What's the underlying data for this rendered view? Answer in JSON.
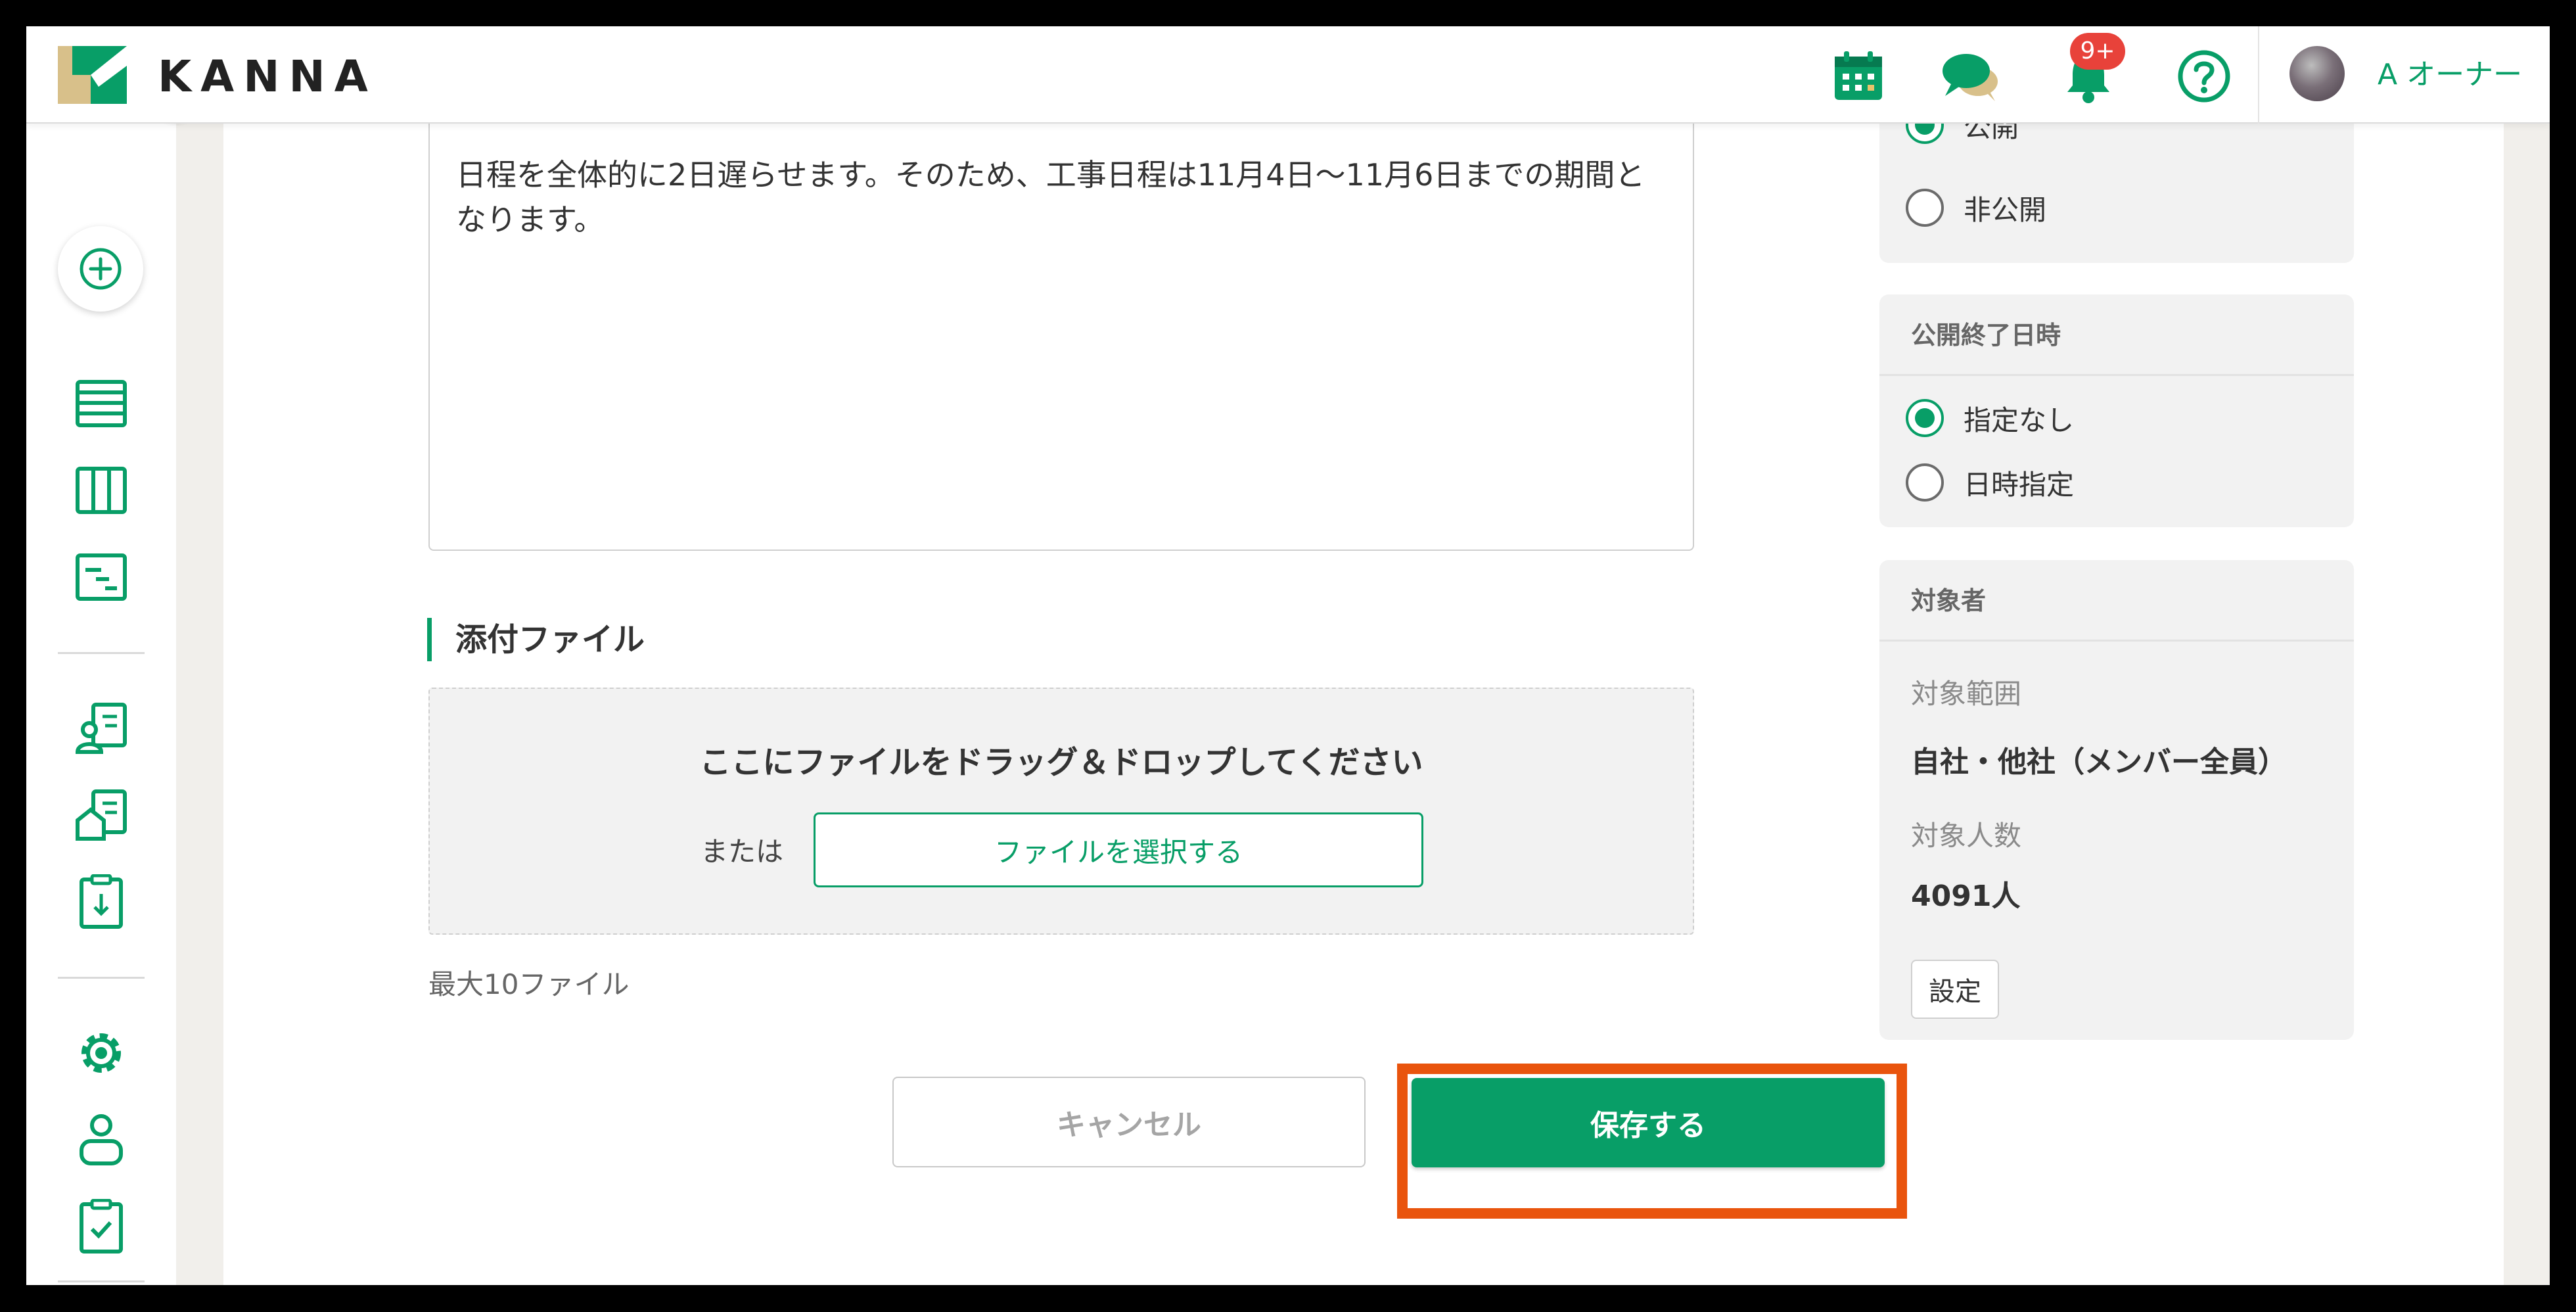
{
  "header": {
    "logo_text": "KANNA",
    "notification_badge": "9+",
    "user_name": "A オーナー"
  },
  "editor": {
    "body_text": "日程を全体的に2日遅らせます。そのため、工事日程は11月4日〜11月6日までの期間となります。"
  },
  "attachments": {
    "section_title": "添付ファイル",
    "drop_text": "ここにファイルをドラッグ＆ドロップしてください",
    "or_text": "または",
    "select_button": "ファイルを選択する",
    "max_note": "最大10ファイル"
  },
  "actions": {
    "cancel_label": "キャンセル",
    "save_label": "保存する"
  },
  "visibility_panel": {
    "options": [
      "公開",
      "非公開"
    ],
    "selected": "公開"
  },
  "end_date_panel": {
    "title": "公開終了日時",
    "options": [
      "指定なし",
      "日時指定"
    ],
    "selected": "指定なし"
  },
  "target_panel": {
    "title": "対象者",
    "range_label": "対象範囲",
    "range_value": "自社・他社（メンバー全員）",
    "count_label": "対象人数",
    "count_value": "4091人",
    "setting_button": "設定"
  },
  "colors": {
    "brand_green": "#089e67",
    "highlight_orange": "#e9540d",
    "badge_red": "#e8423a",
    "logo_tan": "#d8c08a"
  },
  "icons": {
    "sidebar": [
      "add-icon",
      "list-icon",
      "board-icon",
      "gantt-icon",
      "customer-card-icon",
      "house-card-icon",
      "clipboard-download-icon",
      "settings-icon",
      "person-icon",
      "clipboard-check-icon"
    ],
    "header": [
      "calendar-icon",
      "chat-icon",
      "bell-icon",
      "help-icon"
    ]
  }
}
